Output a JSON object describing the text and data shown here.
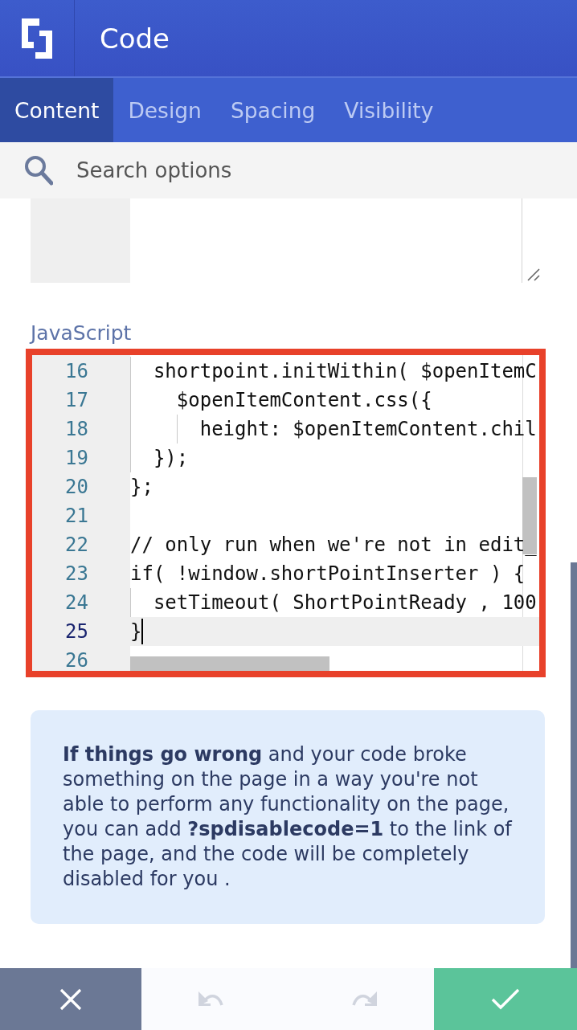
{
  "header": {
    "title": "Code"
  },
  "tabs": [
    {
      "label": "Content",
      "selected": true
    },
    {
      "label": "Design",
      "selected": false
    },
    {
      "label": "Spacing",
      "selected": false
    },
    {
      "label": "Visibility",
      "selected": false
    }
  ],
  "search": {
    "placeholder": "Search options"
  },
  "javascript_editor": {
    "label": "JavaScript",
    "highlighted": true,
    "lines": [
      {
        "number": "16",
        "text": "  shortpoint.initWithin( $openItemC",
        "active": false
      },
      {
        "number": "17",
        "text": "    $openItemContent.css({",
        "active": false
      },
      {
        "number": "18",
        "text": "      height: $openItemContent.chil",
        "active": false
      },
      {
        "number": "19",
        "text": "  });",
        "active": false
      },
      {
        "number": "20",
        "text": "};",
        "active": false
      },
      {
        "number": "21",
        "active": false
      },
      {
        "number": "22",
        "text": "// only run when we're not in edit_",
        "active": false
      },
      {
        "number": "23",
        "text": "if( !window.shortPointInserter ) {",
        "active": false
      },
      {
        "number": "24",
        "text": "  setTimeout( ShortPointReady , 100",
        "active": false
      },
      {
        "number": "25",
        "text": "}",
        "active": true
      },
      {
        "number": "26",
        "active": false
      }
    ]
  },
  "notice": {
    "text": "**If things go wrong** and your code broke something on the page in a way you're not able to perform any functionality on the page, you can add **?spdisablecode=1** to the link of the page, and the code will be completely disabled for you ."
  },
  "actions": [
    {
      "kind": "cancel"
    },
    {
      "kind": "undo",
      "disabled": true
    },
    {
      "kind": "redo",
      "disabled": true
    },
    {
      "kind": "confirm"
    }
  ]
}
